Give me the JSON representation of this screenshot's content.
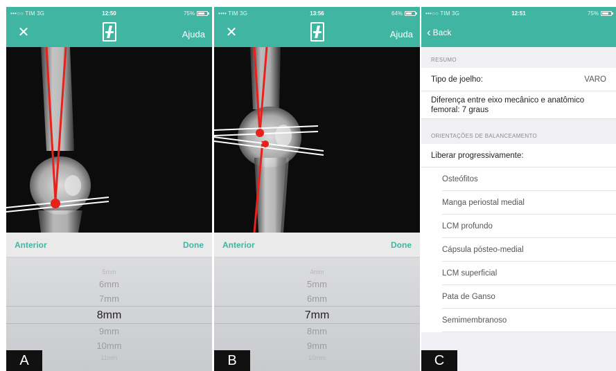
{
  "panels": [
    {
      "status": {
        "carrier": "•••○○ TIM  3G",
        "time": "12:50",
        "battery": "75%",
        "battery_level": 0.75
      },
      "header": {
        "help": "Ajuda"
      },
      "picker": {
        "prev_label": "Anterior",
        "done_label": "Done",
        "options_above": [
          "5mm",
          "6mm",
          "7mm"
        ],
        "selected": "8mm",
        "options_below": [
          "9mm",
          "10mm",
          "11mm"
        ]
      },
      "tag": "A"
    },
    {
      "status": {
        "carrier": "•••• TIM  3G",
        "time": "13:56",
        "battery": "64%",
        "battery_level": 0.64
      },
      "header": {
        "help": "Ajuda"
      },
      "picker": {
        "prev_label": "Anterior",
        "done_label": "Done",
        "options_above": [
          "4mm",
          "5mm",
          "6mm"
        ],
        "selected": "7mm",
        "options_below": [
          "8mm",
          "9mm",
          "10mm"
        ]
      },
      "tag": "B"
    },
    {
      "status": {
        "carrier": "•••○○ TIM  3G",
        "time": "12:51",
        "battery": "75%",
        "battery_level": 0.75
      },
      "header": {
        "back": "Back"
      },
      "summary": {
        "section1": "RESUMO",
        "knee_type_label": "Tipo de joelho:",
        "knee_type_value": "VARO",
        "axis_difference": "Diferença entre eixo mecânico e anatômico femoral: 7 graus",
        "section2": "ORIENTAÇÕES DE BALANCEAMENTO",
        "release_label": "Liberar progressivamente:",
        "release_items": [
          "Osteófitos",
          "Manga periostal medial",
          "LCM profundo",
          "Cápsula pósteo-medial",
          "LCM superficial",
          "Pata de Ganso",
          "Semimembranoso"
        ]
      },
      "tag": "C"
    }
  ],
  "colors": {
    "accent": "#3fb5a2",
    "axis_line": "#e8211c",
    "xray_bg": "#0c0c0c"
  }
}
